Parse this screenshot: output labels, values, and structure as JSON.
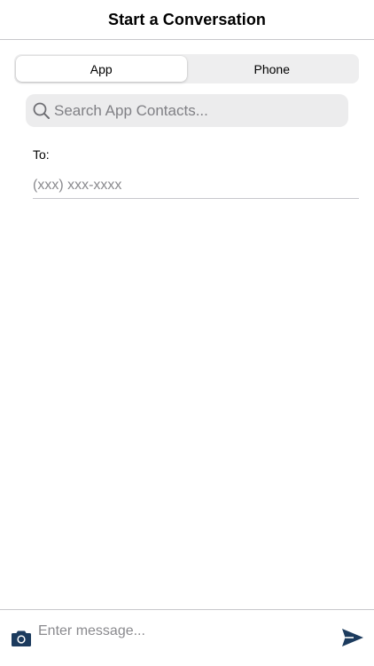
{
  "header": {
    "title": "Start a Conversation"
  },
  "segmented_control": {
    "segments": [
      {
        "label": "App",
        "selected": true
      },
      {
        "label": "Phone",
        "selected": false
      }
    ]
  },
  "search": {
    "placeholder": "Search App Contacts...",
    "icon": "magnifying-glass"
  },
  "recipient": {
    "label": "To:",
    "placeholder": "(xxx) xxx-xxxx"
  },
  "composer": {
    "placeholder": "Enter message...",
    "camera_icon": "camera",
    "send_icon": "paper-plane-arrow"
  },
  "colors": {
    "accent": "#1c3b5e",
    "divider": "#c8c8cc",
    "segment_bg": "#eeeeef",
    "search_bg": "#ececed",
    "placeholder": "#8a8a8e"
  }
}
